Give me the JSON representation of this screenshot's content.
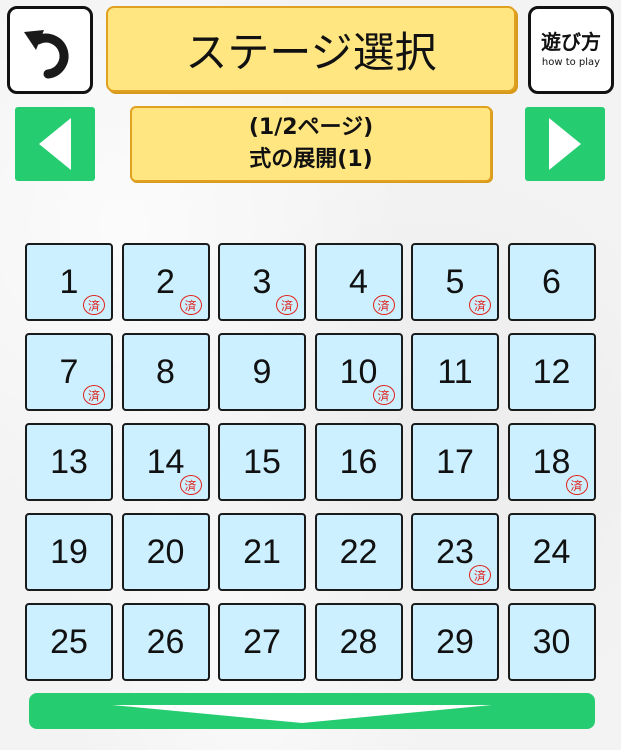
{
  "header": {
    "back_icon": "undo-arrow-icon",
    "title": "ステージ選択",
    "howto_label_jp": "遊び方",
    "howto_label_en": "how to play"
  },
  "pager": {
    "prev_icon": "triangle-left-icon",
    "next_icon": "triangle-right-icon",
    "page_indicator": "(1/2ページ)",
    "category": "式の展開(1)"
  },
  "stamp_label": "済",
  "colors": {
    "accent_green": "#26cc70",
    "title_yellow": "#ffe680",
    "stage_bg": "#ccf0ff",
    "stamp_red": "#e0201a"
  },
  "stages": [
    {
      "number": "1",
      "cleared": true
    },
    {
      "number": "2",
      "cleared": true
    },
    {
      "number": "3",
      "cleared": true
    },
    {
      "number": "4",
      "cleared": true
    },
    {
      "number": "5",
      "cleared": true
    },
    {
      "number": "6",
      "cleared": false
    },
    {
      "number": "7",
      "cleared": true
    },
    {
      "number": "8",
      "cleared": false
    },
    {
      "number": "9",
      "cleared": false
    },
    {
      "number": "10",
      "cleared": true
    },
    {
      "number": "11",
      "cleared": false
    },
    {
      "number": "12",
      "cleared": false
    },
    {
      "number": "13",
      "cleared": false
    },
    {
      "number": "14",
      "cleared": true
    },
    {
      "number": "15",
      "cleared": false
    },
    {
      "number": "16",
      "cleared": false
    },
    {
      "number": "17",
      "cleared": false
    },
    {
      "number": "18",
      "cleared": true
    },
    {
      "number": "19",
      "cleared": false
    },
    {
      "number": "20",
      "cleared": false
    },
    {
      "number": "21",
      "cleared": false
    },
    {
      "number": "22",
      "cleared": false
    },
    {
      "number": "23",
      "cleared": true
    },
    {
      "number": "24",
      "cleared": false
    },
    {
      "number": "25",
      "cleared": false
    },
    {
      "number": "26",
      "cleared": false
    },
    {
      "number": "27",
      "cleared": false
    },
    {
      "number": "28",
      "cleared": false
    },
    {
      "number": "29",
      "cleared": false
    },
    {
      "number": "30",
      "cleared": false
    }
  ],
  "footer": {
    "scroll_icon": "chevron-down-icon"
  }
}
